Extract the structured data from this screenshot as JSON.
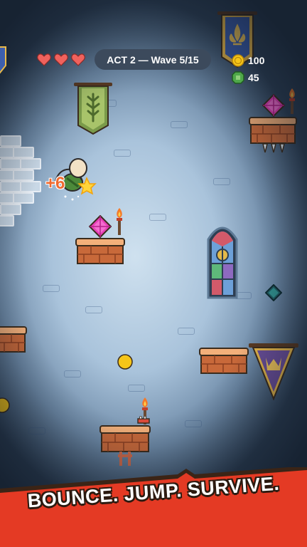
{
  "hud": {
    "hearts": 3,
    "wave_label": "ACT 2 — Wave 5/15",
    "coins": "100",
    "gems": "45"
  },
  "floating_score": "+6",
  "tagline": "BOUNCE. JUMP. SURVIVE.",
  "icons": {
    "heart": "heart-icon",
    "coin": "coin-icon",
    "gem": "gem-icon"
  },
  "colors": {
    "heart": "#f0625d",
    "hud_pill": "#3c4a5c",
    "platform_top": "#f3b07a",
    "platform_brick": "#c8693a",
    "gem_pink": "#e83fb7",
    "banner_red": "#e43a24",
    "coin_yellow": "#f5c518"
  }
}
